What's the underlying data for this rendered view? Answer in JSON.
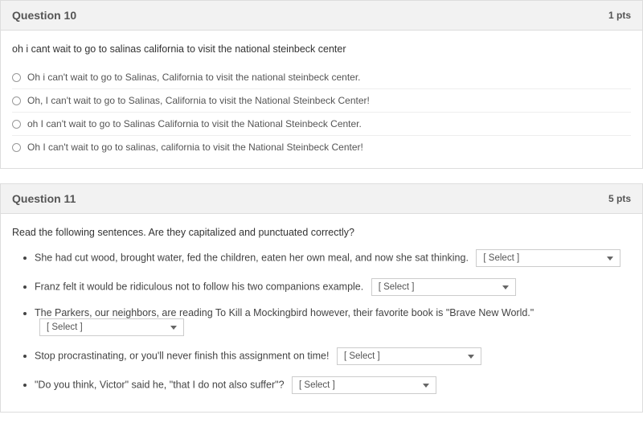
{
  "q10": {
    "title": "Question 10",
    "points": "1 pts",
    "prompt": "oh i cant wait to go to salinas california to visit the national steinbeck center",
    "options": [
      "Oh i can't wait to go to Salinas, California to visit the national steinbeck center.",
      "Oh, I can't wait to go to Salinas, California to visit the National Steinbeck Center!",
      "oh I can't wait to go to Salinas California to visit the National Steinbeck Center.",
      "Oh I can't wait to go to salinas, california to visit the National Steinbeck Center!"
    ]
  },
  "q11": {
    "title": "Question 11",
    "points": "5 pts",
    "prompt": "Read the following sentences.  Are they capitalized and punctuated correctly?",
    "select_placeholder": "[ Select ]",
    "items": [
      "She had cut wood, brought water, fed the children, eaten her own meal, and now she sat thinking.",
      "Franz felt it would be ridiculous not to follow his two companions example.",
      "The Parkers, our neighbors, are reading To Kill a Mockingbird however, their favorite book is \"Brave New World.\"",
      "Stop procrastinating, or you'll never finish this assignment on time!",
      "\"Do you think, Victor\" said he, \"that I do not also suffer\"?"
    ]
  }
}
